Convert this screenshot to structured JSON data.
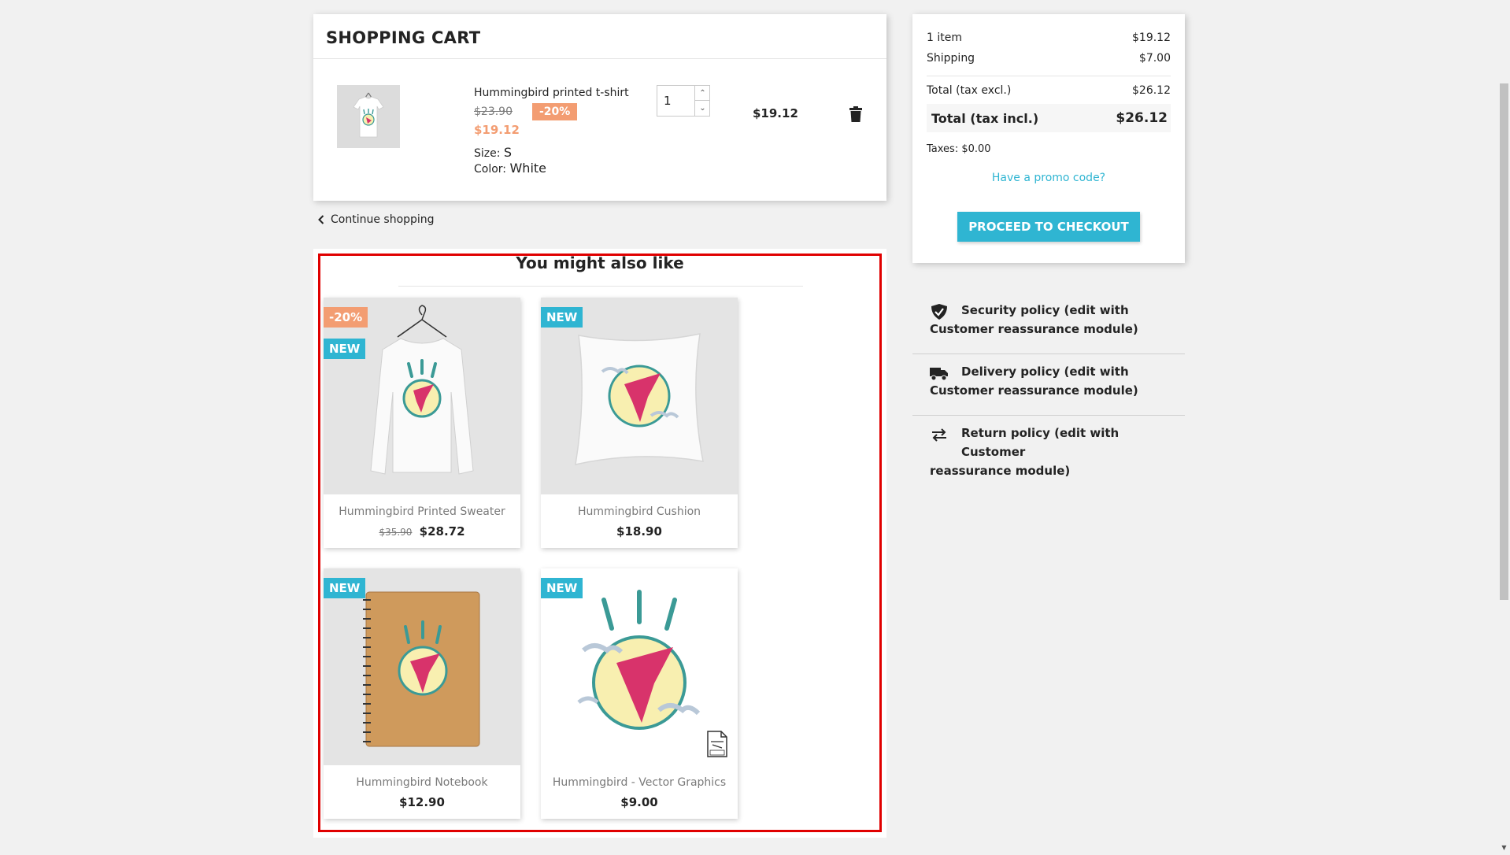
{
  "cart": {
    "title": "SHOPPING CART",
    "item": {
      "name": "Hummingbird printed t-shirt",
      "old_price": "$23.90",
      "discount": "-20%",
      "price": "$19.12",
      "size_label": "Size:",
      "size_value": "S",
      "color_label": "Color:",
      "color_value": "White",
      "quantity": "1",
      "line_total": "$19.12"
    },
    "continue_label": "Continue shopping"
  },
  "related": {
    "title": "You might also like",
    "products": [
      {
        "name": "Hummingbird Printed Sweater",
        "old_price": "$35.90",
        "price": "$28.72",
        "flags": [
          "-20%",
          "NEW"
        ]
      },
      {
        "name": "Hummingbird Cushion",
        "price": "$18.90",
        "flags": [
          "NEW"
        ]
      },
      {
        "name": "Hummingbird Notebook",
        "price": "$12.90",
        "flags": [
          "NEW"
        ]
      },
      {
        "name": "Hummingbird - Vector Graphics",
        "price": "$9.00",
        "flags": [
          "NEW"
        ]
      }
    ]
  },
  "summary": {
    "items_label": "1 item",
    "items_value": "$19.12",
    "shipping_label": "Shipping",
    "shipping_value": "$7.00",
    "excl_label": "Total (tax excl.)",
    "excl_value": "$26.12",
    "incl_label": "Total (tax incl.)",
    "incl_value": "$26.12",
    "taxes": "Taxes: $0.00",
    "promo": "Have a promo code?",
    "checkout": "PROCEED TO CHECKOUT"
  },
  "reassurance": [
    {
      "line1": "Security policy (edit with",
      "line2": "Customer reassurance module)",
      "icon": "shield-icon"
    },
    {
      "line1": "Delivery policy (edit with",
      "line2": "Customer reassurance module)",
      "icon": "truck-icon"
    },
    {
      "line1": "Return policy (edit with Customer",
      "line2": "reassurance module)",
      "icon": "swap-arrows-icon"
    }
  ],
  "colors": {
    "accent": "#2fb5d2",
    "discount": "#f39d72",
    "highlight_border": "#e00000"
  }
}
